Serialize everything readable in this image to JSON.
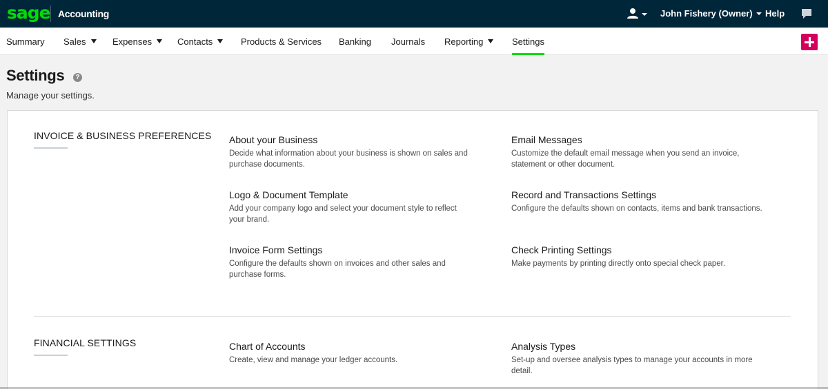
{
  "topbar": {
    "logo": "sage",
    "app_name": "Accounting",
    "user_label": "John Fishery (Owner)",
    "help_label": "Help"
  },
  "nav": {
    "items": [
      {
        "label": "Summary"
      },
      {
        "label": "Sales"
      },
      {
        "label": "Expenses"
      },
      {
        "label": "Contacts"
      },
      {
        "label": "Products & Services"
      },
      {
        "label": "Banking"
      },
      {
        "label": "Journals"
      },
      {
        "label": "Reporting"
      },
      {
        "label": "Settings"
      }
    ],
    "active": "Settings"
  },
  "page": {
    "title": "Settings",
    "help_glyph": "?",
    "subtitle": "Manage your settings."
  },
  "sections": [
    {
      "title": "INVOICE & BUSINESS PREFERENCES",
      "items": [
        {
          "title": "About your Business",
          "desc": "Decide what information about your business is shown on sales and purchase documents."
        },
        {
          "title": "Email Messages",
          "desc": "Customize the default email message when you send an invoice, statement or other document."
        },
        {
          "title": "Logo & Document Template",
          "desc": "Add your company logo and select your document style to reflect your brand."
        },
        {
          "title": "Record and Transactions Settings",
          "desc": "Configure the defaults shown on contacts, items and bank transactions."
        },
        {
          "title": "Invoice Form Settings",
          "desc": "Configure the defaults shown on invoices and other sales and purchase forms."
        },
        {
          "title": "Check Printing Settings",
          "desc": "Make payments by printing directly onto special check paper."
        }
      ]
    },
    {
      "title": "FINANCIAL SETTINGS",
      "items": [
        {
          "title": "Chart of Accounts",
          "desc": "Create, view and manage your ledger accounts."
        },
        {
          "title": "Analysis Types",
          "desc": "Set-up and oversee analysis types to manage your accounts in more detail."
        }
      ]
    }
  ],
  "colors": {
    "topbar_bg": "#00263a",
    "brand_green": "#00dc06",
    "add_button": "#d5005e"
  }
}
